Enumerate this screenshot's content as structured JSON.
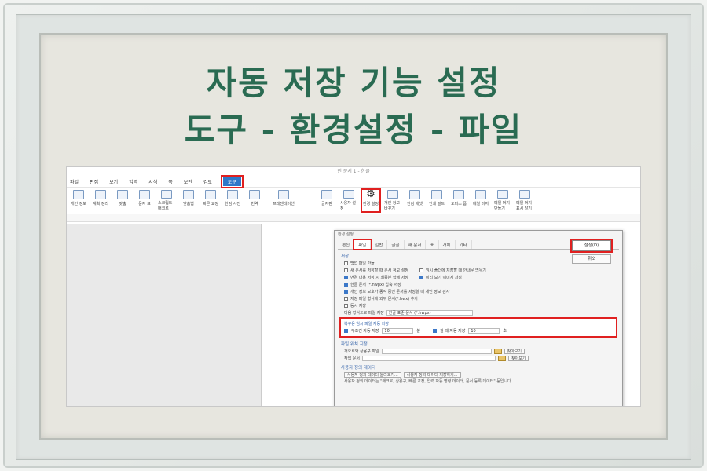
{
  "heading": {
    "line1": "자동 저장 기능 설정",
    "line2": "도구 - 환경설정 - 파일"
  },
  "app": {
    "window_title": "빈 문서 1 - 한글"
  },
  "menu": [
    "파일",
    "편집",
    "보기",
    "입력",
    "서식",
    "쪽",
    "보안",
    "검토",
    "도구"
  ],
  "ribbon_left": [
    "개인 정보",
    "계획 정리",
    "맞춤",
    "문자 표",
    "스크립트 매크로",
    "맞춤법",
    "빠른 교정",
    "한컴 사전",
    "번역",
    "프레젠테이션"
  ],
  "ribbon_right": [
    "글자판",
    "사용자 설정",
    "환경 설정",
    "개인 정보 바꾸기",
    "한컴 애셋",
    "인쇄 필드",
    "오피스 폼",
    "메일 머지",
    "메일 머지 만들기",
    "메일 머지 표시 달기"
  ],
  "dialog": {
    "title": "환경 설정",
    "tabs": [
      "편집",
      "파일",
      "일반",
      "글꼴",
      "새 문서",
      "표",
      "개체",
      "기타"
    ],
    "set_button": "설정(D)",
    "cancel_button": "취소",
    "save_section": "저장",
    "options": [
      {
        "label": "백업 파일 만듦",
        "checked": false
      },
      {
        "label": "새 문서를 저장할 때 문서 정보 설정",
        "checked": false
      },
      {
        "label": "변경 내용 저장 시 최종본 함께 저장",
        "checked": true
      },
      {
        "label": "한글 문서 (*.hwpx) 압축 저장",
        "checked": true
      },
      {
        "label": "개인 정보 보호가 동작 중인 문서를 저장할 때 개인 정보 검사",
        "checked": true
      },
      {
        "label": "저장 파일 형식에 외부 문서(*.hwx) 추가",
        "checked": false
      },
      {
        "label": "동시 저장",
        "checked": false
      }
    ],
    "side_options": [
      {
        "label": "임시 폴더에 저장할 때 안내문 띄우기",
        "checked": false
      },
      {
        "label": "미리 보기 이미지 저장",
        "checked": true
      }
    ],
    "default_format_label": "다음 형식으로 파일 저장",
    "default_format_value": "한글 표준 문서 (*.hwpx)",
    "autosave": {
      "title": "복구용 임시 파일 자동 저장",
      "interval_label": "무조건 자동 저장",
      "interval_value": "10",
      "interval_unit": "분",
      "idle_label": "쉴 때 자동 저장",
      "idle_value": "10",
      "idle_unit": "초"
    },
    "path_section": "파일 위치 지정",
    "template_label": "개요르와 상용구 파일",
    "work_label": "작업 문서",
    "browse_button": "찾아보기",
    "userdata_section": "사용자 정의 데이터",
    "userdata_btn1": "사용자 정의 데이터 불러오기...",
    "userdata_btn2": "사용자 정의 데이터 저장하기...",
    "note": "사용자 정의 데이터는 \"매크로, 상용구, 빠른 교정, 입력 자동 명령 데이터, 문서 등록 데이터\" 등입니다."
  }
}
